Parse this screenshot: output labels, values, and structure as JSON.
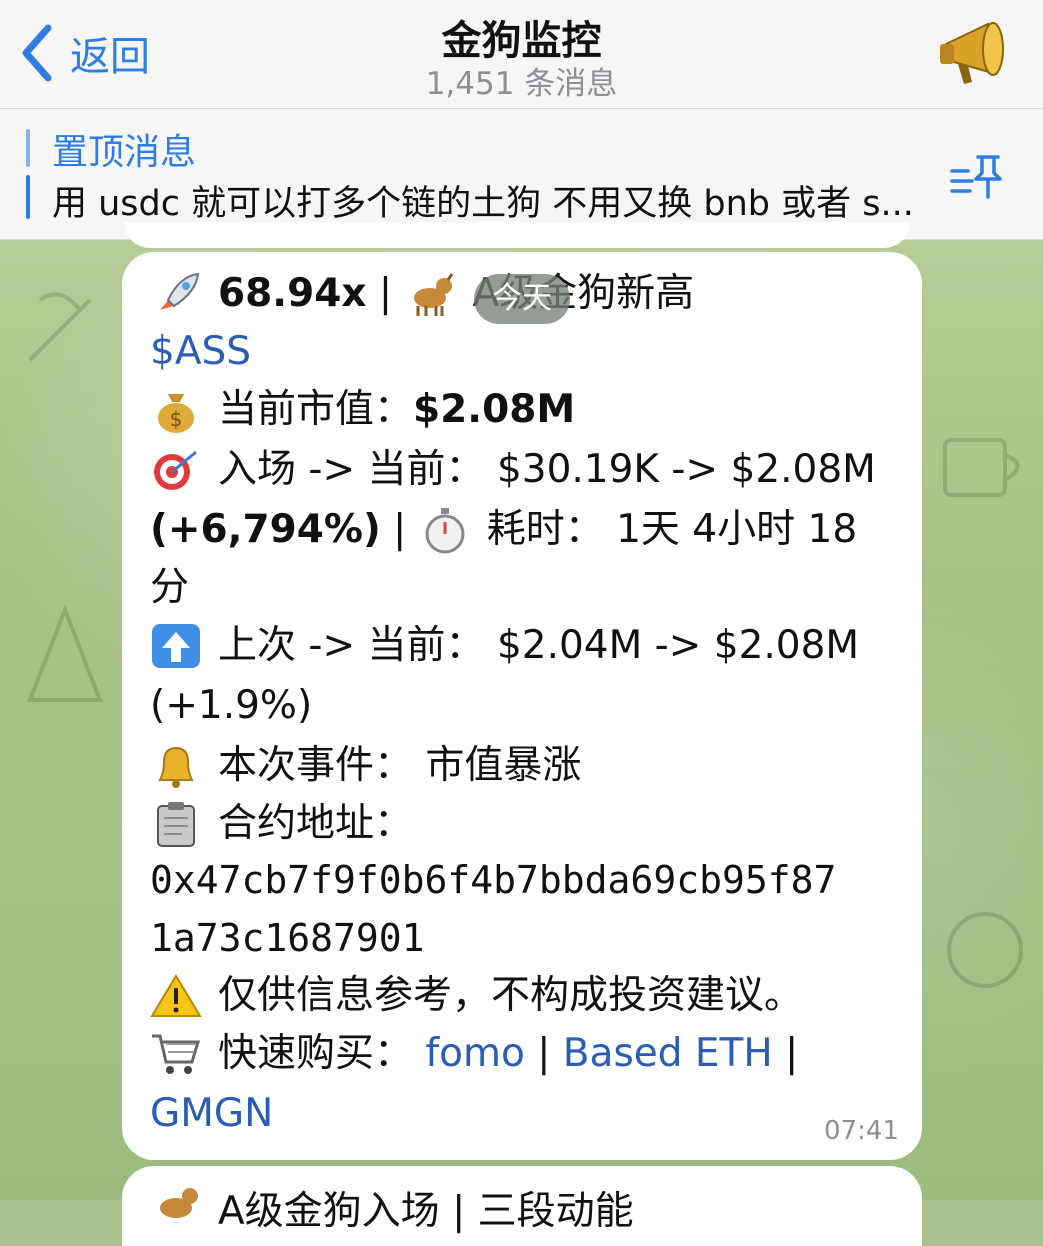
{
  "header": {
    "back_label": "返回",
    "title": "金狗监控",
    "subtitle": "1,451 条消息"
  },
  "pinned": {
    "title": "置顶消息",
    "text": "用 usdc 就可以打多个链的土狗 不用又换 bnb 或者 s..."
  },
  "date_pill": "今天",
  "message": {
    "line1_multiplier": "68.94x",
    "line1_sep": " | ",
    "line1_title": "A级金狗新高",
    "ticker": "$ASS",
    "mcap_label": "当前市值：",
    "mcap_value": "$2.08M",
    "entry_text": "入场 -> 当前：  $30.19K -> $2.08M",
    "entry_pct": "(+6,794%)",
    "elapsed_text": " | ",
    "elapsed_label": "耗时：  1天 4小时 18",
    "elapsed_tail": "分",
    "last_text": "上次 -> 当前：  $2.04M -> $2.08M",
    "last_pct": "(+1.9%)",
    "event_text": "本次事件：  市值暴涨",
    "contract_label": "合约地址：",
    "contract_line1": "0x47cb7f9f0b6f4b7bbda69cb95f87",
    "contract_line2": "1a73c1687901",
    "warning_text": "仅供信息参考，不构成投资建议。",
    "buy_label": "快速购买：  ",
    "buy_links": [
      "fomo",
      "Based ETH",
      "GMGN"
    ],
    "buy_sep": " | ",
    "time": "07:41"
  },
  "next_message": {
    "text": "A级金狗入场 | 三段动能"
  },
  "colors": {
    "accent": "#2f7de1",
    "link": "#2a5db5",
    "background": "#a9c28e"
  },
  "icons": [
    "chevron-left-icon",
    "megaphone-icon",
    "pin-list-icon",
    "rocket-icon",
    "dog-icon",
    "money-bag-icon",
    "target-icon",
    "stopwatch-icon",
    "up-arrow-icon",
    "bell-icon",
    "clipboard-icon",
    "warning-icon",
    "shopping-cart-icon"
  ]
}
